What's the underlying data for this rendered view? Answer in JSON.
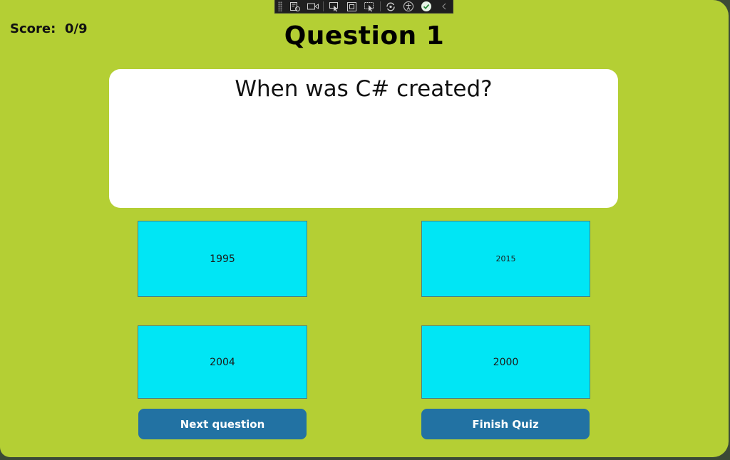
{
  "colors": {
    "window_background": "#b4cf34",
    "question_card": "#ffffff",
    "answer_button": "#00e6f5",
    "action_button": "#2272a3",
    "action_button_text": "#ffffff"
  },
  "debug_toolbar": {
    "icons": [
      "live-visual-tree-icon",
      "record-icon",
      "select-element-icon",
      "display-layout-adorners-icon",
      "track-focused-element-icon",
      "hot-reload-icon",
      "accessibility-icon",
      "binding-check-icon",
      "collapse-chevron-icon"
    ]
  },
  "score": {
    "label": "Score:",
    "value": "0/9"
  },
  "question": {
    "title": "Question 1",
    "text": "When was C# created?"
  },
  "answers": [
    {
      "label": "1995"
    },
    {
      "label": "2015"
    },
    {
      "label": "2004"
    },
    {
      "label": "2000"
    }
  ],
  "actions": {
    "next_label": "Next question",
    "finish_label": "Finish Quiz"
  }
}
